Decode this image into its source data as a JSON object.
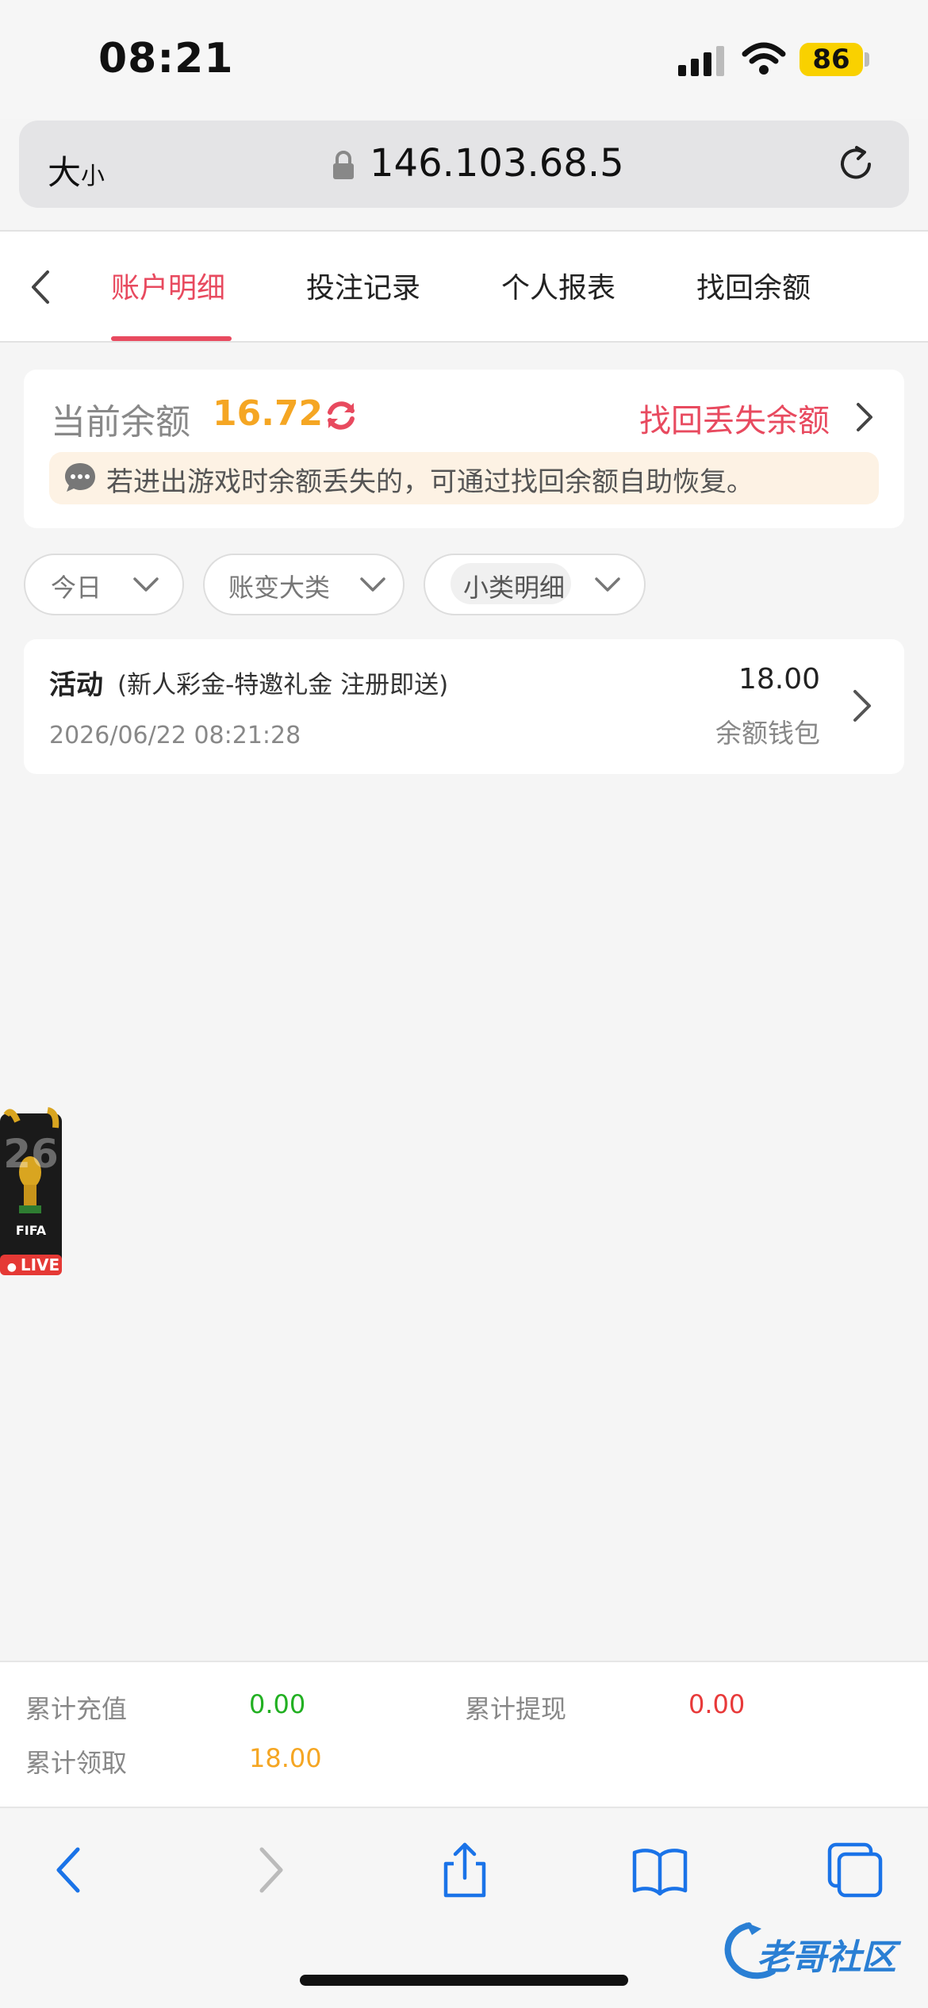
{
  "status_bar": {
    "time": "08:21",
    "battery": "86",
    "signal_icon": "cellular-signal-icon",
    "wifi_icon": "wifi-icon"
  },
  "browser": {
    "text_size_label": "大",
    "text_size_small": "小",
    "url": "146.103.68.5"
  },
  "tabs": [
    {
      "label": "账户明细",
      "active": true
    },
    {
      "label": "投注记录",
      "active": false
    },
    {
      "label": "个人报表",
      "active": false
    },
    {
      "label": "找回余额",
      "active": false
    }
  ],
  "balance": {
    "label": "当前余额",
    "value": "16.72",
    "recover_link": "找回丢失余额",
    "notice": "若进出游戏时余额丢失的，可通过找回余额自助恢复。"
  },
  "filters": [
    {
      "label": "今日"
    },
    {
      "label": "账变大类"
    },
    {
      "label": "小类明细"
    }
  ],
  "records": [
    {
      "title": "活动",
      "description": "(新人彩金-特邀礼金 注册即送)",
      "time": "2026/06/22 08:21:28",
      "amount": "18.00",
      "wallet": "余额钱包"
    }
  ],
  "floating_badge": {
    "digits": "26",
    "brand": "FIFA",
    "live": "LIVE"
  },
  "summary": {
    "recharge_label": "累计充值",
    "recharge_value": "0.00",
    "withdraw_label": "累计提现",
    "withdraw_value": "0.00",
    "claimed_label": "累计领取",
    "claimed_value": "18.00"
  },
  "watermark": "老哥社区",
  "colors": {
    "accent": "#e84a5f",
    "balance": "#f5a623",
    "recharge": "#22b022",
    "withdraw": "#e83a3a",
    "claimed": "#f5a623"
  }
}
